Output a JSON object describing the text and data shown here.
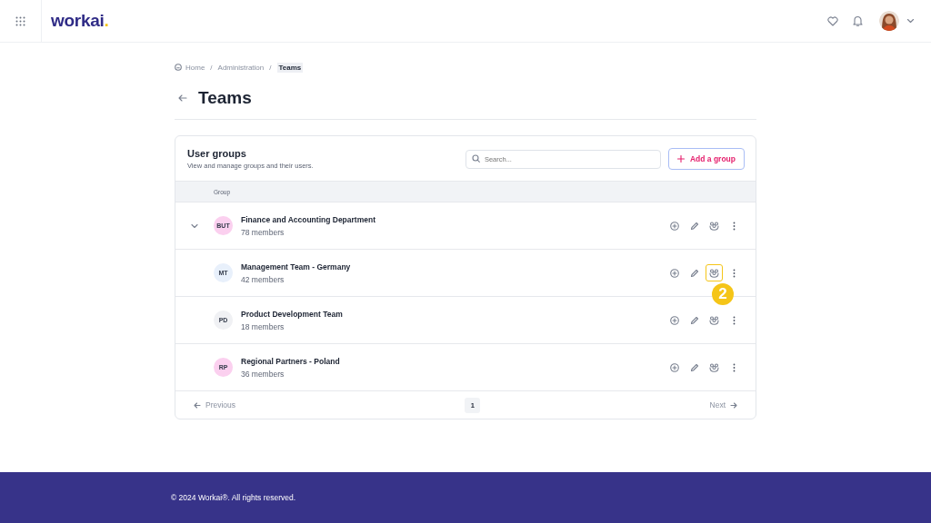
{
  "header": {
    "logo": {
      "text": "workai",
      "dot": "."
    }
  },
  "breadcrumb": [
    {
      "label": "Home",
      "current": false
    },
    {
      "label": "Administration",
      "current": false
    },
    {
      "label": "Teams",
      "current": true
    }
  ],
  "breadcrumb_separator": "/",
  "page_title": "Teams",
  "card": {
    "title": "User groups",
    "subtitle": "View and manage groups and their users.",
    "search": {
      "placeholder": "Search..."
    },
    "add_button": "Add a group"
  },
  "table": {
    "columns": [
      "Group"
    ],
    "rows": [
      {
        "initials": "BUT",
        "name": "Finance and Accounting Department",
        "members": "78 members",
        "color": "#fbd0ef",
        "toggle": {
          "expanded": true
        },
        "highlighted": false
      },
      {
        "initials": "MT",
        "name": "Management Team - Germany",
        "members": "42 members",
        "color": "#e8f0fb",
        "highlighted": true,
        "callout": "2"
      },
      {
        "initials": "PD",
        "name": "Product Development Team",
        "members": "18 members",
        "color": "#f0f1f4",
        "highlighted": false
      },
      {
        "initials": "RP",
        "name": "Regional Partners - Poland",
        "members": "36 members",
        "color": "#fbd0ef",
        "highlighted": false
      }
    ]
  },
  "pagination": {
    "previous": "Previous",
    "pages": [
      {
        "label": "1",
        "selected": true
      }
    ],
    "next": "Next"
  },
  "footer": {
    "text": "© 2024 Workai®. All rights reserved."
  }
}
